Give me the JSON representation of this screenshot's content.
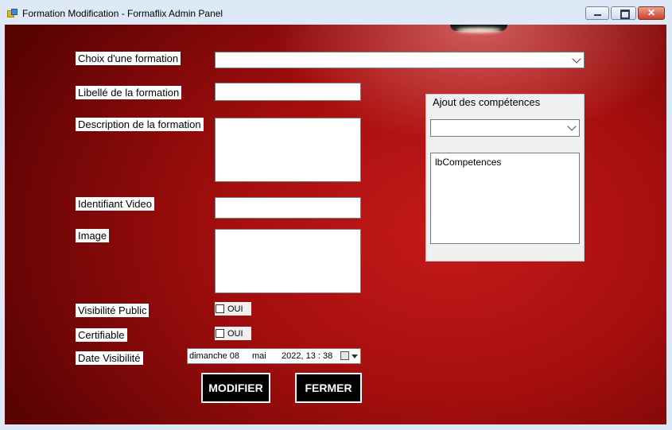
{
  "window": {
    "title": "Formation Modification - Formaflix Admin Panel",
    "controls": {
      "minimize": "",
      "maximize": "",
      "close": "✕"
    }
  },
  "form": {
    "choix_label": "Choix d'une formation",
    "choix_value": "",
    "libelle_label": "Libellé de la formation",
    "libelle_value": "",
    "description_label": "Description de la formation",
    "description_value": "",
    "video_label": "Identifiant Video",
    "video_value": "",
    "image_label": "Image",
    "visibilite_label": "Visibilité Public",
    "visibilite_checkbox": "OUI",
    "visibilite_checked": false,
    "certifiable_label": "Certifiable",
    "certifiable_checkbox": "OUI",
    "certifiable_checked": false,
    "date_label": "Date Visibilité",
    "date": {
      "day_name": "dimanche 08",
      "month": "mai",
      "year_time": "2022, 13 : 38"
    }
  },
  "competences": {
    "group_title": "Ajout des compétences",
    "combo_value": "",
    "listbox_text": "lbCompetences"
  },
  "buttons": {
    "modifier": "MODIFIER",
    "fermer": "FERMER"
  },
  "colors": {
    "background_red": "#b01212",
    "button_black": "#000000",
    "panel_gray": "#f0f0f0",
    "titlebar": "#dde9f6"
  }
}
